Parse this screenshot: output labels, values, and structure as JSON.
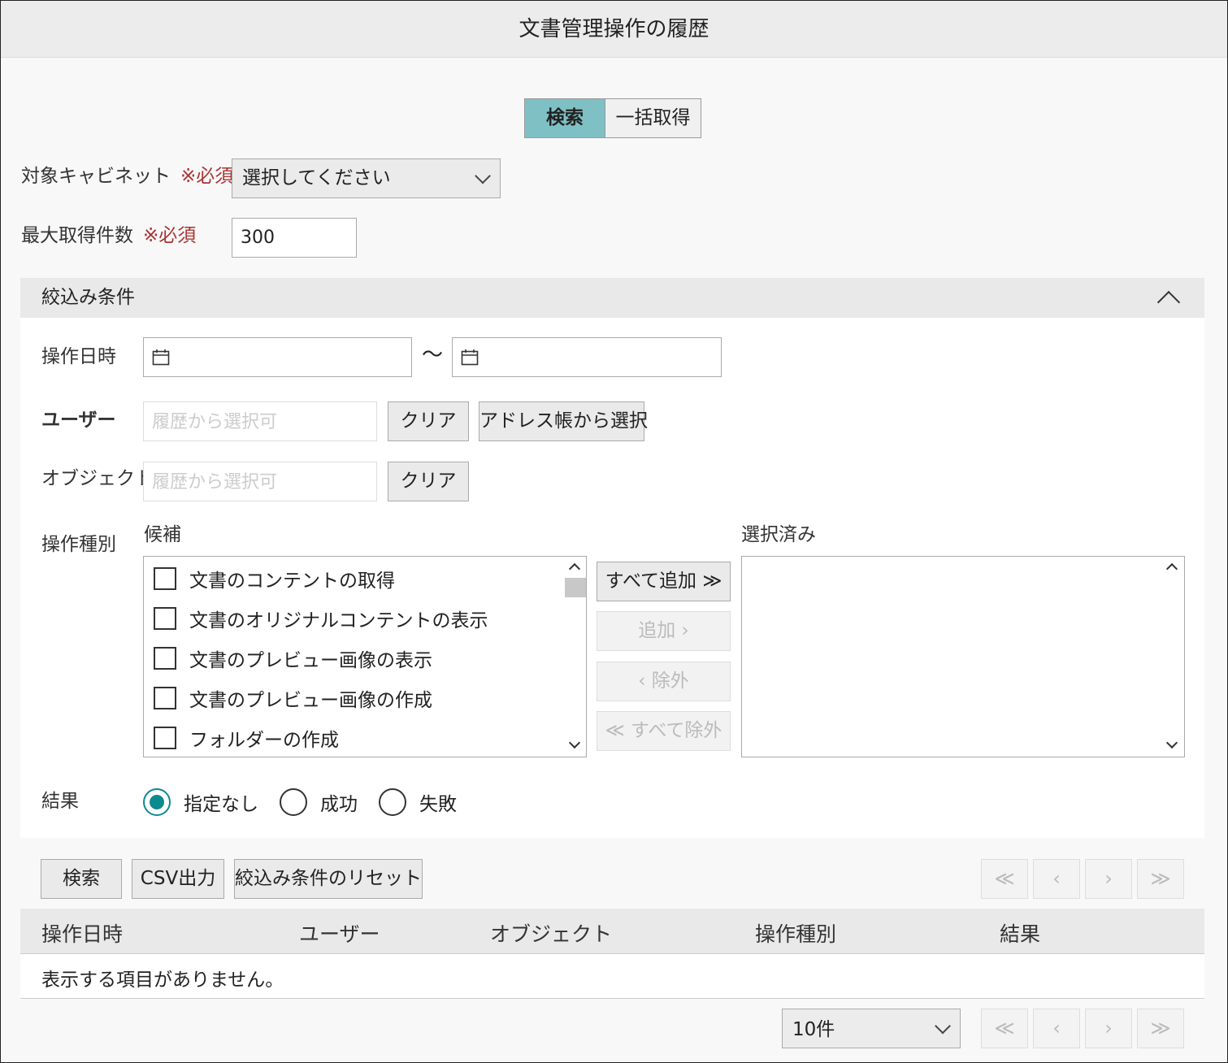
{
  "window": {
    "title": "文書管理操作の履歴"
  },
  "mode_tabs": {
    "search": "検索",
    "bulk": "一括取得"
  },
  "form": {
    "cabinet_label": "対象キャビネット",
    "required_mark": "※必須",
    "cabinet_value": "選択してください",
    "max_label": "最大取得件数",
    "max_value": "300"
  },
  "filter": {
    "title": "絞込み条件",
    "date_label": "操作日時",
    "date_sep": "〜",
    "user_label": "ユーザー",
    "user_placeholder": "履歴から選択可",
    "clear_label": "クリア",
    "address_book_label": "アドレス帳から選択",
    "object_label": "オブジェクト",
    "object_placeholder": "履歴から選択可",
    "op_type_label": "操作種別",
    "candidates_label": "候補",
    "selected_label": "選択済み",
    "candidates": [
      "文書のコンテントの取得",
      "文書のオリジナルコンテントの表示",
      "文書のプレビュー画像の表示",
      "文書のプレビュー画像の作成",
      "フォルダーの作成"
    ],
    "add_all": "すべて追加 ≫",
    "add": "追加 ›",
    "remove": "‹ 除外",
    "remove_all": "≪ すべて除外",
    "result_label": "結果",
    "results": [
      "指定なし",
      "成功",
      "失敗"
    ]
  },
  "actions": {
    "search": "検索",
    "csv": "CSV出力",
    "reset": "絞込み条件のリセット"
  },
  "pager": {
    "first": "≪",
    "prev": "‹",
    "next": "›",
    "last": "≫",
    "page_size": "10件"
  },
  "table": {
    "columns": [
      "操作日時",
      "ユーザー",
      "オブジェクト",
      "操作種別",
      "結果"
    ],
    "empty_message": "表示する項目がありません。"
  },
  "colors": {
    "accent": "#0d8a90",
    "tab_active": "#7fc0c4",
    "required": "#aa3333"
  },
  "icons": {
    "calendar": "calendar-icon",
    "chevron_down": "chevron-down-icon",
    "chevron_up": "chevron-up-icon"
  }
}
